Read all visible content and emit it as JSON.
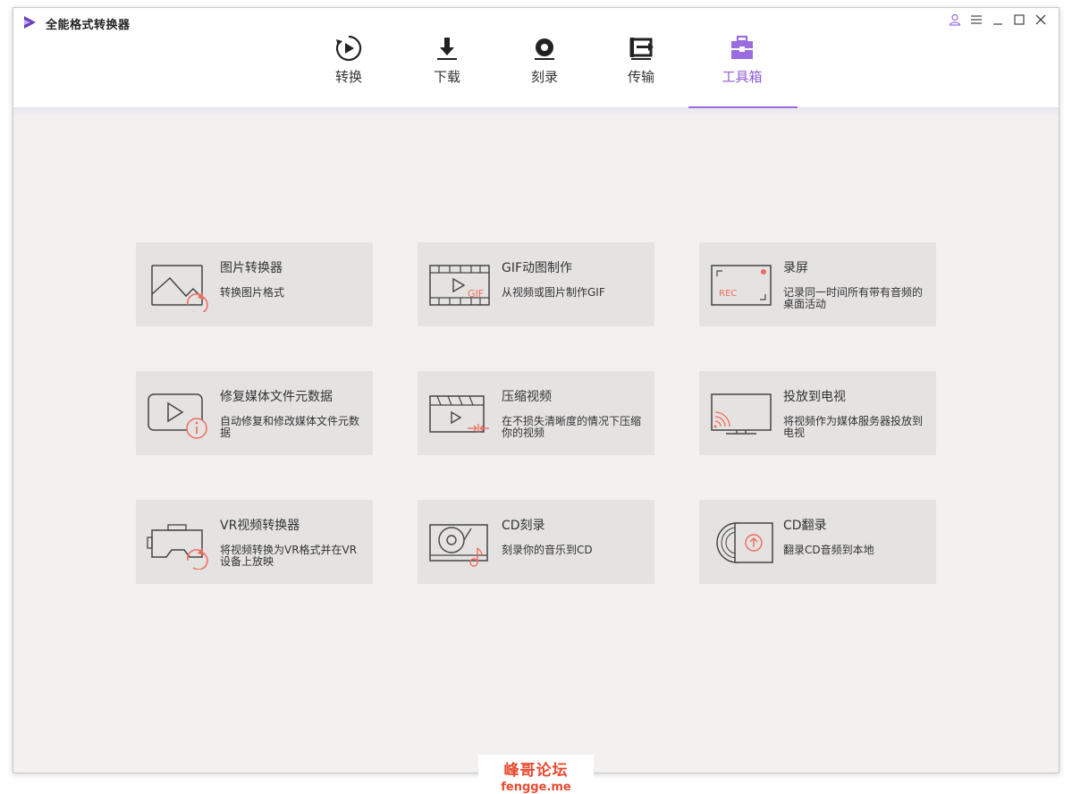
{
  "app": {
    "title": "全能格式转换器"
  },
  "nav": {
    "tabs": [
      {
        "label": "转换",
        "icon": "convert-icon"
      },
      {
        "label": "下载",
        "icon": "download-icon"
      },
      {
        "label": "刻录",
        "icon": "burn-icon"
      },
      {
        "label": "传输",
        "icon": "transfer-icon"
      },
      {
        "label": "工具箱",
        "icon": "toolbox-icon",
        "active": true
      }
    ]
  },
  "tools": [
    {
      "title": "图片转换器",
      "desc": "转换图片格式",
      "icon": "image-convert-icon"
    },
    {
      "title": "GIF动图制作",
      "desc": "从视频或图片制作GIF",
      "icon": "gif-maker-icon"
    },
    {
      "title": "录屏",
      "desc": "记录同一时间所有带有音频的桌面活动",
      "icon": "screen-record-icon"
    },
    {
      "title": "修复媒体文件元数据",
      "desc": "自动修复和修改媒体文件元数据",
      "icon": "metadata-fix-icon"
    },
    {
      "title": "压缩视频",
      "desc": "在不损失清晰度的情况下压缩你的视频",
      "icon": "compress-video-icon"
    },
    {
      "title": "投放到电视",
      "desc": "将视频作为媒体服务器投放到电视",
      "icon": "cast-tv-icon"
    },
    {
      "title": "VR视频转换器",
      "desc": "将视频转换为VR格式并在VR设备上放映",
      "icon": "vr-convert-icon"
    },
    {
      "title": "CD刻录",
      "desc": "刻录你的音乐到CD",
      "icon": "cd-burn-icon"
    },
    {
      "title": "CD翻录",
      "desc": "翻录CD音频到本地",
      "icon": "cd-rip-icon"
    }
  ],
  "watermark": {
    "cn": "峰哥论坛",
    "en": "fengge.me"
  },
  "colors": {
    "accent": "#9a6ce0",
    "icon_red": "#f06a5a",
    "card_bg": "#e4e3e2"
  }
}
